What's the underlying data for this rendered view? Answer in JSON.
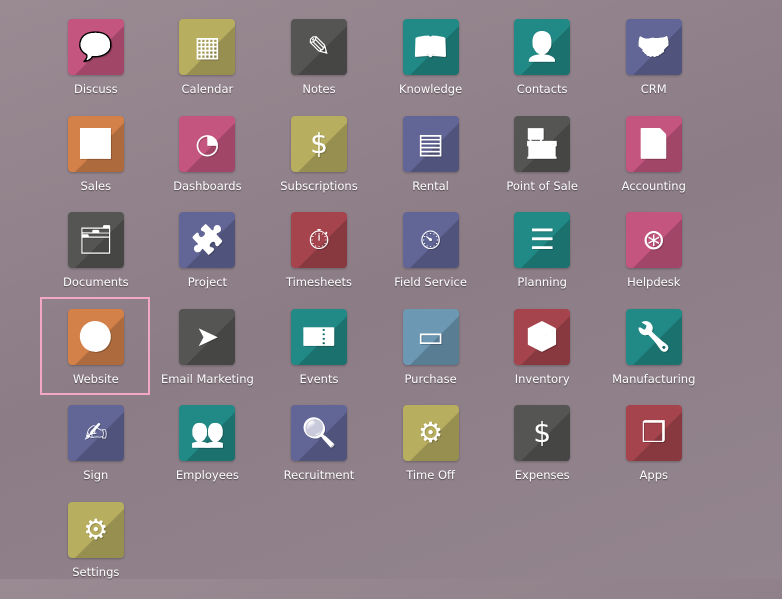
{
  "colors": {
    "pink": "#c4557e",
    "olive": "#b8ae60",
    "gray": "#555553",
    "teal": "#218a86",
    "slate": "#626697",
    "orange": "#d38149",
    "red": "#a6444d",
    "blue": "#6c98b3",
    "selection": "#f4a7c4"
  },
  "apps": [
    {
      "label": "Discuss",
      "icon": "chat-bubble-icon",
      "glyph": "💬",
      "color": "pink"
    },
    {
      "label": "Calendar",
      "icon": "calendar-icon",
      "glyph": "▦",
      "color": "olive"
    },
    {
      "label": "Notes",
      "icon": "notes-pencil-icon",
      "glyph": "✎",
      "color": "gray"
    },
    {
      "label": "Knowledge",
      "icon": "book-icon",
      "glyph": "📖",
      "color": "teal"
    },
    {
      "label": "Contacts",
      "icon": "address-book-icon",
      "glyph": "👤",
      "color": "teal"
    },
    {
      "label": "CRM",
      "icon": "handshake-icon",
      "glyph": "🤝",
      "color": "slate"
    },
    {
      "label": "Sales",
      "icon": "trend-chart-icon",
      "glyph": "📈",
      "color": "orange"
    },
    {
      "label": "Dashboards",
      "icon": "gauge-icon",
      "glyph": "◔",
      "color": "pink"
    },
    {
      "label": "Subscriptions",
      "icon": "recurring-dollar-icon",
      "glyph": "$",
      "color": "olive"
    },
    {
      "label": "Rental",
      "icon": "gantt-grid-icon",
      "glyph": "▤",
      "color": "slate"
    },
    {
      "label": "Point of Sale",
      "icon": "shop-icon",
      "glyph": "🏪",
      "color": "gray"
    },
    {
      "label": "Accounting",
      "icon": "document-gear-icon",
      "glyph": "📄",
      "color": "pink"
    },
    {
      "label": "Documents",
      "icon": "inbox-tray-icon",
      "glyph": "🗂",
      "color": "gray"
    },
    {
      "label": "Project",
      "icon": "puzzle-icon",
      "glyph": "🧩",
      "color": "slate"
    },
    {
      "label": "Timesheets",
      "icon": "stopwatch-icon",
      "glyph": "⏱",
      "color": "red"
    },
    {
      "label": "Field Service",
      "icon": "puzzle-clock-icon",
      "glyph": "⏲",
      "color": "slate"
    },
    {
      "label": "Planning",
      "icon": "planning-clock-icon",
      "glyph": "☰",
      "color": "teal"
    },
    {
      "label": "Helpdesk",
      "icon": "lifebuoy-icon",
      "glyph": "⊛",
      "color": "pink"
    },
    {
      "label": "Website",
      "icon": "globe-icon",
      "glyph": "🌎",
      "color": "orange"
    },
    {
      "label": "Email Marketing",
      "icon": "paper-plane-icon",
      "glyph": "➤",
      "color": "gray"
    },
    {
      "label": "Events",
      "icon": "ticket-icon",
      "glyph": "🎫",
      "color": "teal"
    },
    {
      "label": "Purchase",
      "icon": "credit-card-icon",
      "glyph": "▭",
      "color": "blue"
    },
    {
      "label": "Inventory",
      "icon": "open-box-icon",
      "glyph": "📦",
      "color": "red"
    },
    {
      "label": "Manufacturing",
      "icon": "wrench-icon",
      "glyph": "🔧",
      "color": "teal"
    },
    {
      "label": "Sign",
      "icon": "signature-document-icon",
      "glyph": "✍",
      "color": "slate"
    },
    {
      "label": "Employees",
      "icon": "people-group-icon",
      "glyph": "👥",
      "color": "teal"
    },
    {
      "label": "Recruitment",
      "icon": "magnifier-person-icon",
      "glyph": "🔍",
      "color": "slate"
    },
    {
      "label": "Time Off",
      "icon": "person-gear-icon",
      "glyph": "⚙",
      "color": "olive"
    },
    {
      "label": "Expenses",
      "icon": "person-dollar-icon",
      "glyph": "$",
      "color": "gray"
    },
    {
      "label": "Apps",
      "icon": "cubes-icon",
      "glyph": "❒",
      "color": "red"
    },
    {
      "label": "Settings",
      "icon": "gear-icon",
      "glyph": "⚙",
      "color": "olive"
    }
  ],
  "selected": "Website"
}
